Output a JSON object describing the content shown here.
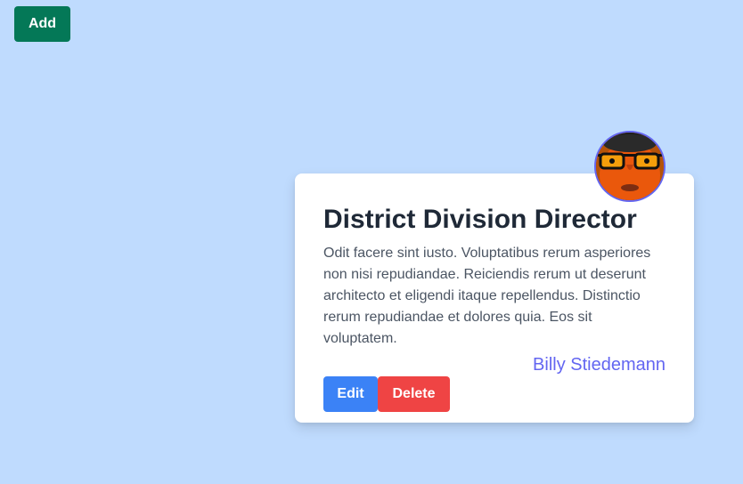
{
  "toolbar": {
    "add_label": "Add"
  },
  "card": {
    "title": "District Division Director",
    "description": "Odit facere sint iusto. Voluptatibus rerum asperiores non nisi repudiandae. Reiciendis rerum ut deserunt architecto et eligendi itaque repellendus. Distinctio rerum repudiandae et dolores quia. Eos sit voluptatem.",
    "author": "Billy Stiedemann",
    "edit_label": "Edit",
    "delete_label": "Delete"
  },
  "colors": {
    "background": "#bfdbfe",
    "add_button": "#047857",
    "edit_button": "#3b82f6",
    "delete_button": "#ef4444",
    "author_text": "#6366f1"
  }
}
